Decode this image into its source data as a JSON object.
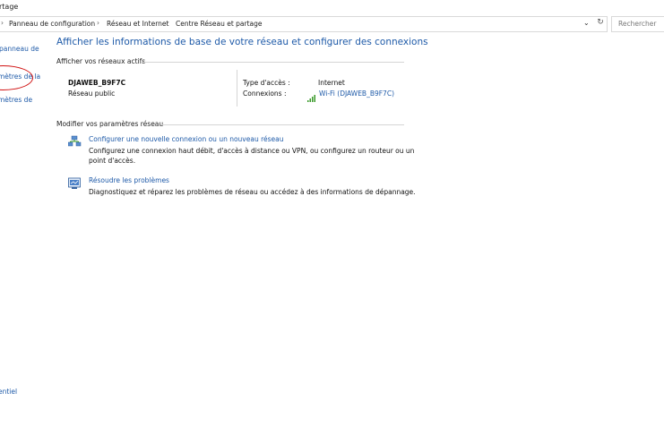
{
  "window": {
    "title": "rtage"
  },
  "address": {
    "crumbs": [
      "Panneau de configuration",
      "Réseau et Internet",
      "Centre Réseau et partage"
    ],
    "search_placeholder": "Rechercher"
  },
  "sidebar": {
    "items": [
      "panneau de",
      "mètres de la",
      "mètres de"
    ],
    "bottom": "entiel"
  },
  "main": {
    "title": "Afficher les informations de base de votre réseau et configurer des connexions",
    "active_section": "Afficher vos réseaux actifs",
    "network": {
      "name": "DJAWEB_B9F7C",
      "type": "Réseau public",
      "access_label": "Type d'accès :",
      "access_value": "Internet",
      "conn_label": "Connexions :",
      "conn_value": "Wi-Fi (DJAWEB_B9F7C)"
    },
    "modify_section": "Modifier vos paramètres réseau",
    "tasks": [
      {
        "title": "Configurer une nouvelle connexion ou un nouveau réseau",
        "desc1": "Configurez une connexion haut débit, d'accès à distance ou VPN, ou configurez un routeur ou un",
        "desc2": "point d'accès.",
        "icon": "network-setup-icon"
      },
      {
        "title": "Résoudre les problèmes",
        "desc1": "Diagnostiquez et réparez les problèmes de réseau ou accédez à des informations de dépannage.",
        "icon": "troubleshoot-icon"
      }
    ]
  },
  "colors": {
    "link": "#1e5aa8",
    "annotation": "#d01010",
    "wifi": "#3a9a2a"
  }
}
